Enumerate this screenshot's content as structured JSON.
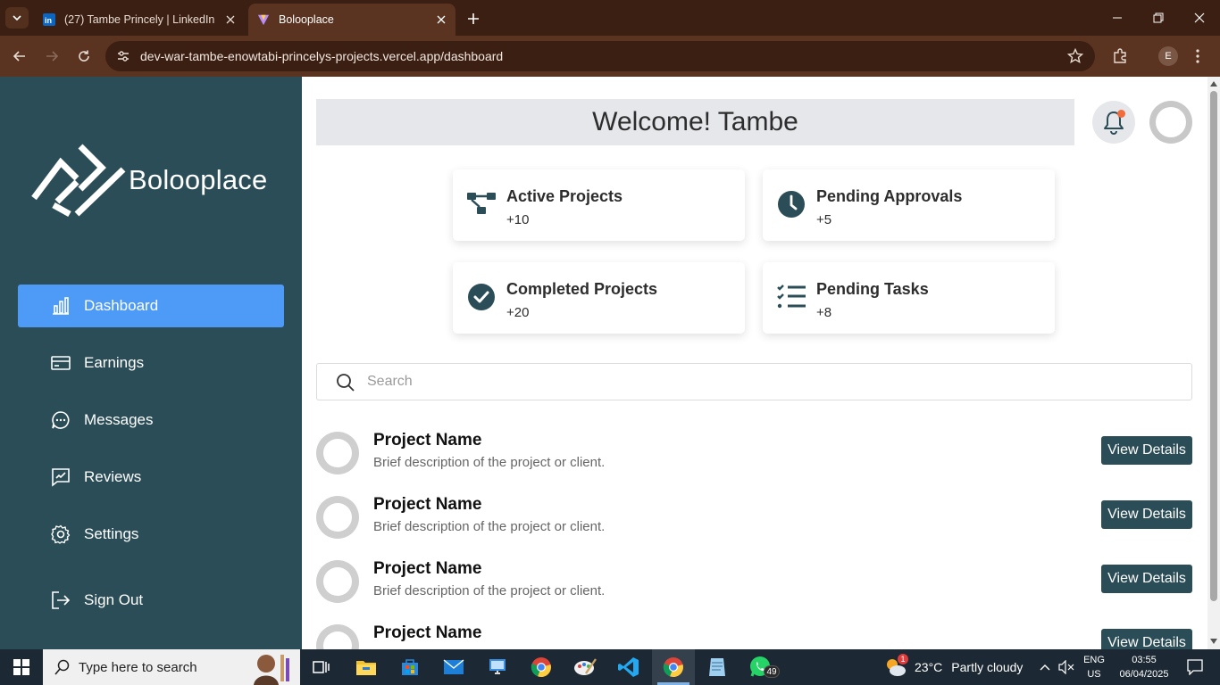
{
  "browser": {
    "tabs": [
      {
        "title": "(27) Tambe Princely | LinkedIn",
        "favicon": "linkedin-icon",
        "active": false
      },
      {
        "title": "Bolooplace",
        "favicon": "bolooplace-icon",
        "active": true
      }
    ],
    "url": "dev-war-tambe-enowtabi-princelys-projects.vercel.app/dashboard",
    "profile_initial": "E"
  },
  "sidebar": {
    "brand": "Bolooplace",
    "items": [
      {
        "label": "Dashboard",
        "icon": "bar-chart-icon",
        "active": true
      },
      {
        "label": "Earnings",
        "icon": "credit-card-icon",
        "active": false
      },
      {
        "label": "Messages",
        "icon": "chat-bubble-icon",
        "active": false
      },
      {
        "label": "Reviews",
        "icon": "review-icon",
        "active": false
      },
      {
        "label": "Settings",
        "icon": "gear-icon",
        "active": false
      },
      {
        "label": "Sign Out",
        "icon": "sign-out-icon",
        "active": false
      }
    ]
  },
  "header": {
    "welcome": "Welcome! Tambe"
  },
  "stats": [
    {
      "label": "Active Projects",
      "value": "+10",
      "icon": "hierarchy-icon"
    },
    {
      "label": "Pending Approvals",
      "value": "+5",
      "icon": "clock-icon"
    },
    {
      "label": "Completed Projects",
      "value": "+20",
      "icon": "check-circle-icon"
    },
    {
      "label": "Pending Tasks",
      "value": "+8",
      "icon": "checklist-icon"
    }
  ],
  "search": {
    "placeholder": "Search"
  },
  "projects": [
    {
      "name": "Project Name",
      "description": "Brief description of the project or client.",
      "button": "View Details"
    },
    {
      "name": "Project Name",
      "description": "Brief description of the project or client.",
      "button": "View Details"
    },
    {
      "name": "Project Name",
      "description": "Brief description of the project or client.",
      "button": "View Details"
    },
    {
      "name": "Project Name",
      "description": "",
      "button": "View Details"
    }
  ],
  "taskbar": {
    "search_placeholder": "Type here to search",
    "whatsapp_badge": "49",
    "weather_temp": "23°C",
    "weather_desc": "Partly cloudy",
    "weather_alert": "1",
    "lang_line1": "ENG",
    "lang_line2": "US",
    "time": "03:55",
    "date": "06/04/2025"
  },
  "colors": {
    "sidebar_bg": "#2b4d57",
    "active_nav": "#4d9af7",
    "button_bg": "#2b4d57",
    "browser_frame": "#3b1f12",
    "notification_dot": "#f26b3a"
  }
}
